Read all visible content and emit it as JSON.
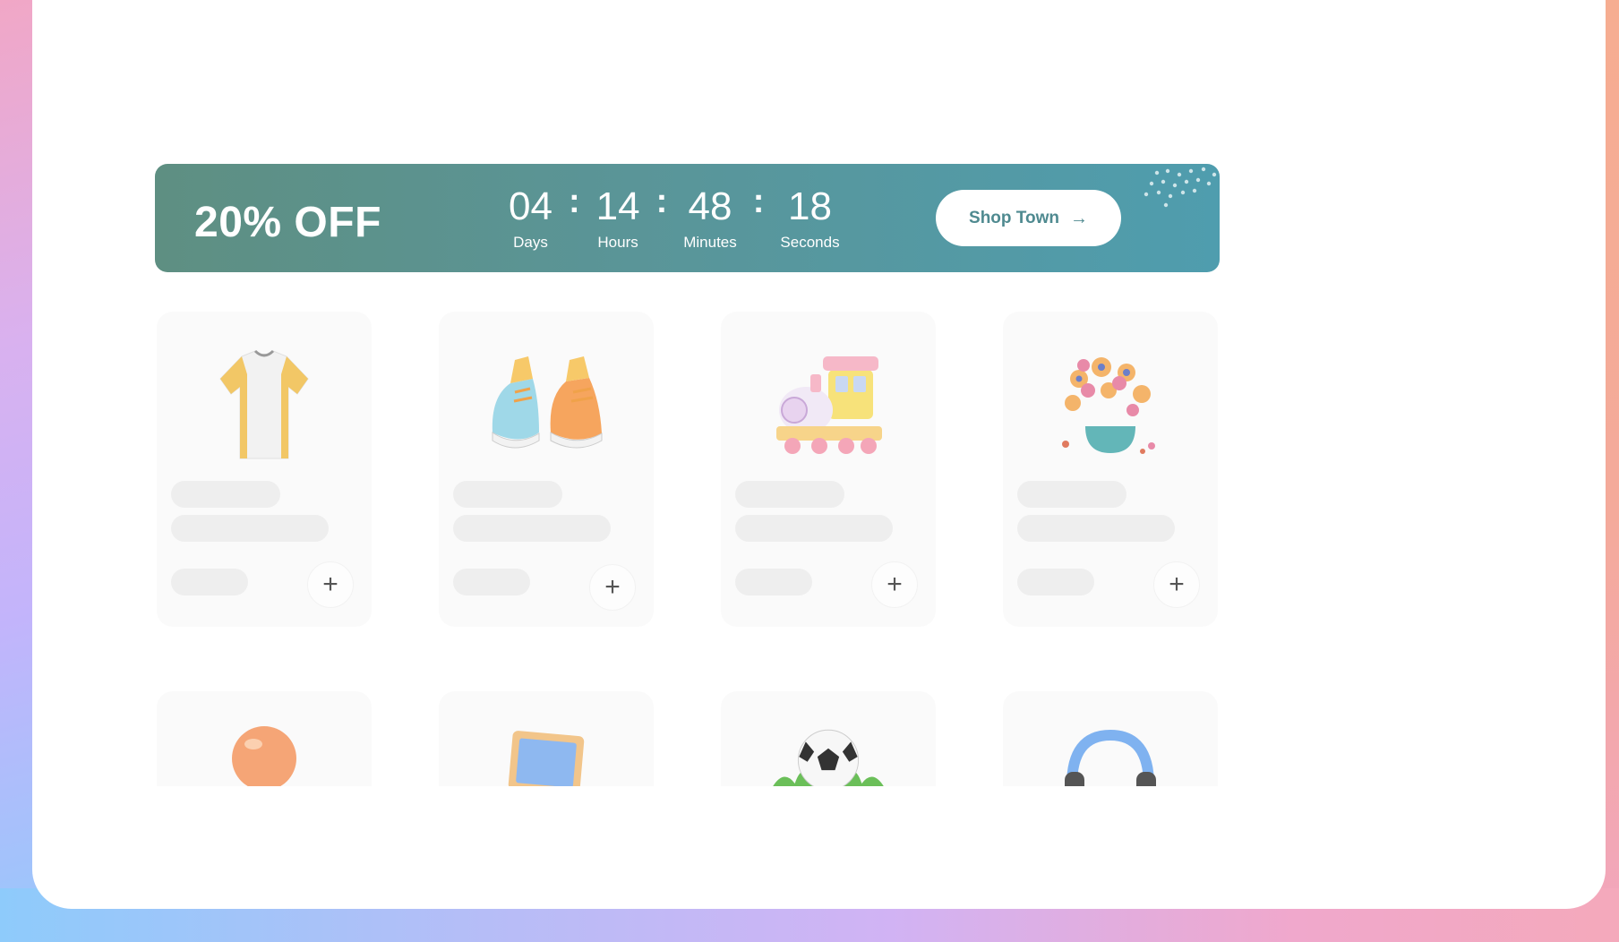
{
  "promo": {
    "title": "20% OFF",
    "countdown": [
      {
        "value": "04",
        "label": "Days"
      },
      {
        "value": "14",
        "label": "Hours"
      },
      {
        "value": "48",
        "label": "Minutes"
      },
      {
        "value": "18",
        "label": "Seconds"
      }
    ],
    "separator": ":",
    "cta_label": "Shop Town",
    "cta_icon": "arrow-right-icon"
  },
  "products": [
    {
      "icon": "tshirt-icon",
      "add_label": "+"
    },
    {
      "icon": "sneakers-icon",
      "add_label": "+"
    },
    {
      "icon": "toy-train-icon",
      "add_label": "+"
    },
    {
      "icon": "flower-pot-icon",
      "add_label": "+"
    }
  ],
  "products_row2": [
    {
      "icon": "ball-icon"
    },
    {
      "icon": "laptop-icon"
    },
    {
      "icon": "soccer-ball-icon"
    },
    {
      "icon": "headphones-icon"
    }
  ],
  "colors": {
    "promo_start": "#5e8f82",
    "promo_end": "#4f9dae",
    "cta_text": "#4f8a90",
    "card_bg": "#fafafa",
    "skeleton": "#eeeeee"
  }
}
